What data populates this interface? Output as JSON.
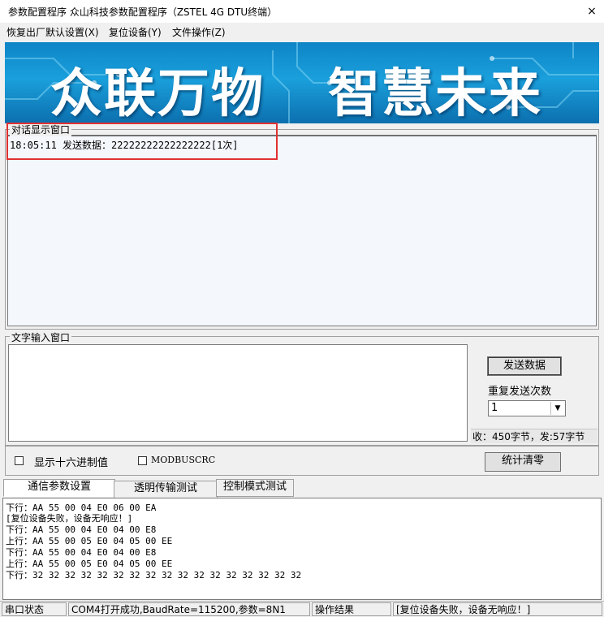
{
  "window": {
    "title": "参数配置程序  众山科技参数配置程序（ZSTEL 4G DTU终端）",
    "close_icon": "×"
  },
  "menu": {
    "items": [
      "恢复出厂默认设置(X)",
      "复位设备(Y)",
      "文件操作(Z)"
    ]
  },
  "banner": {
    "left_text": "众联万物",
    "right_text": "智慧未来"
  },
  "dialog": {
    "label": "对话显示窗口",
    "lines": [
      "18:05:11 发送数据：22222222222222222[1次]"
    ]
  },
  "input": {
    "label": "文字输入窗口",
    "value": "",
    "send_button": "发送数据",
    "repeat_label": "重复发送次数",
    "repeat_value": "1",
    "byte_stats": "收：450字节，发:57字节"
  },
  "options": {
    "hex_label": "显示十六进制值",
    "modbus_label": "MODBUSCRC",
    "clear_button": "统计清零"
  },
  "tabs": [
    "通信参数设置",
    "透明传输测试",
    "控制模式测试"
  ],
  "log": {
    "lines": [
      "下行：AA 55 00 04 E0 06 00 EA",
      "[复位设备失败，设备无响应！]",
      "下行：AA 55 00 04 E0 04 00 E8",
      "上行：AA 55 00 05 E0 04 05 00 EE",
      "下行：AA 55 00 04 E0 04 00 E8",
      "上行：AA 55 00 05 E0 04 05 00 EE",
      "下行：32 32 32 32 32 32 32 32 32 32 32 32 32 32 32 32 32"
    ]
  },
  "status": {
    "port_label": "串口状态",
    "port_value": "COM4打开成功,BaudRate=115200,参数=8N1",
    "result_label": "操作结果",
    "result_value": "[复位设备失败，设备无响应！]"
  },
  "colors": {
    "banner": "#1aa0dc",
    "highlight": "#e03030"
  }
}
